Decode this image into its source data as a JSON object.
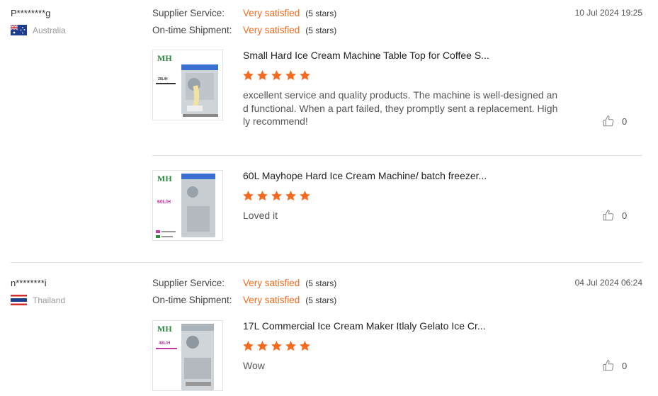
{
  "labels": {
    "supplier_service": "Supplier Service:",
    "ontime_shipment": "On-time Shipment:"
  },
  "reviews": [
    {
      "buyer": "P********g",
      "country": "Australia",
      "flag": "australia-flag",
      "date": "10 Jul 2024 19:25",
      "supplier_service": {
        "value": "Very satisfied",
        "stars_text": "(5 stars)"
      },
      "ontime_shipment": {
        "value": "Very satisfied",
        "stars_text": "(5 stars)"
      },
      "products": [
        {
          "title": "Small Hard Ice Cream Machine Table Top for Coffee S...",
          "thumb_brand": "MH",
          "thumb_text": "20L/H",
          "rating": 5,
          "comment": "excellent service and quality products. The machine is well-designed and functional. When a part failed, they promptly sent a replacement. Highly recommend!",
          "likes": "0"
        },
        {
          "title": "60L Mayhope Hard Ice Cream Machine/ batch freezer...",
          "thumb_brand": "MH",
          "thumb_text": "60L/H",
          "rating": 5,
          "comment": "Loved it",
          "likes": "0"
        }
      ]
    },
    {
      "buyer": "n********i",
      "country": "Thailand",
      "flag": "thailand-flag",
      "date": "04 Jul 2024 06:24",
      "supplier_service": {
        "value": "Very satisfied",
        "stars_text": "(5 stars)"
      },
      "ontime_shipment": {
        "value": "Very satisfied",
        "stars_text": "(5 stars)"
      },
      "products": [
        {
          "title": "17L Commercial Ice Cream Maker Itlaly Gelato Ice Cr...",
          "thumb_brand": "MH",
          "thumb_text": "48L/H",
          "rating": 5,
          "comment": "Wow",
          "likes": "0"
        }
      ]
    }
  ],
  "colors": {
    "accent": "#f56a1f",
    "star": "#f56a1f",
    "divider": "#e2e2e2"
  }
}
